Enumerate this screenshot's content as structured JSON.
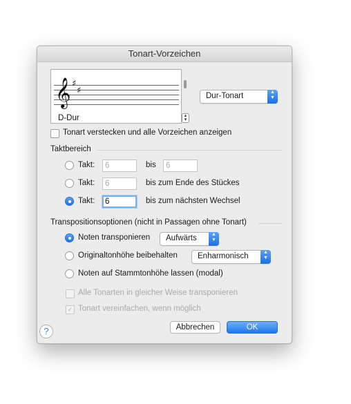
{
  "dialog": {
    "title": "Tonart-Vorzeichen"
  },
  "preview": {
    "clef": "𝄞",
    "sharp": "♯",
    "key_label": "D-Dur"
  },
  "key_type": {
    "selected": "Dur-Tonart"
  },
  "hide_key": {
    "label": "Tonart verstecken und alle Vorzeichen anzeigen",
    "checked": false
  },
  "measure_range": {
    "heading": "Taktbereich",
    "rows": [
      {
        "label": "Takt:",
        "from": "6",
        "bis": "bis",
        "to": "6",
        "selected": false
      },
      {
        "label": "Takt:",
        "from": "6",
        "suffix": "bis zum Ende des Stückes",
        "selected": false
      },
      {
        "label": "Takt:",
        "from": "6",
        "suffix": "bis zum nächsten Wechsel",
        "selected": true
      }
    ]
  },
  "transposition": {
    "heading": "Transpositionsoptionen (nicht in Passagen ohne Tonart)",
    "option1": {
      "label": "Noten transponieren",
      "selected": true,
      "direction": "Aufwärts"
    },
    "option2": {
      "label": "Originaltonhöhe beibehalten",
      "selected": false,
      "mode": "Enharmonisch"
    },
    "option3": {
      "label": "Noten auf Stammtonhöhe lassen (modal)",
      "selected": false
    },
    "check1": {
      "label": "Alle Tonarten in gleicher Weise transponieren",
      "checked": false,
      "enabled": false
    },
    "check2": {
      "label": "Tonart vereinfachen, wenn möglich",
      "checked": true,
      "enabled": false
    }
  },
  "footer": {
    "help": "?",
    "cancel": "Abbrechen",
    "ok": "OK"
  },
  "icons": {
    "popup_arrows": "chevron-updown-icon",
    "checkmark": "✓"
  },
  "colors": {
    "accent": "#1f76ee",
    "dialog_bg": "#ececec"
  }
}
